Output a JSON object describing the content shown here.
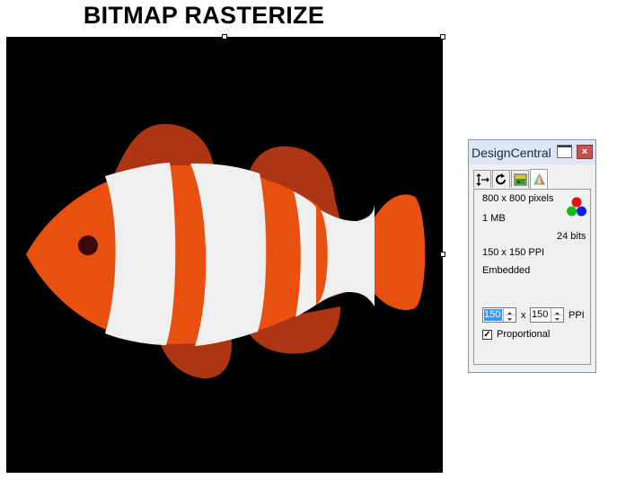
{
  "page": {
    "title": "BITMAP RASTERIZE"
  },
  "canvas": {
    "background": "#000000"
  },
  "fish": {
    "colors": {
      "body_orange": "#e8500f",
      "fin_dark": "#ad3513",
      "stripe_white": "#efefef",
      "eye": "#3a0a0a"
    }
  },
  "panel": {
    "title": "DesignCentral",
    "close_label": "×",
    "tabs": [
      {
        "icon": "move-arrows-icon"
      },
      {
        "icon": "rotate-icon"
      },
      {
        "icon": "bitmap-icon"
      },
      {
        "icon": "color-prism-icon"
      }
    ],
    "info": {
      "dimensions": "800 x 800 pixels",
      "size": "1 MB",
      "bits": "24 bits",
      "ppi": "150 x 150 PPI",
      "status": "Embedded"
    },
    "resolution": {
      "ppi_x": "150",
      "separator": "x",
      "ppi_y": "150",
      "unit": "PPI"
    },
    "proportional": {
      "label": "Proportional",
      "checked": true
    }
  }
}
